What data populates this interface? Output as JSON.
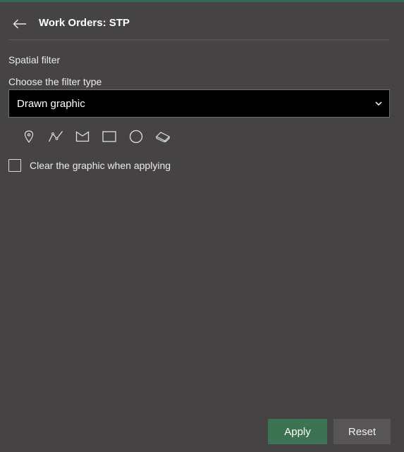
{
  "header": {
    "title": "Work Orders: STP",
    "back_icon": "arrow-left-icon"
  },
  "filter": {
    "section_title": "Spatial filter",
    "type_label": "Choose the filter type",
    "type_value": "Drawn graphic",
    "dropdown_icon": "chevron-down-icon"
  },
  "tools": [
    {
      "name": "point",
      "icon": "point-pin-icon"
    },
    {
      "name": "polyline",
      "icon": "polyline-icon"
    },
    {
      "name": "polygon",
      "icon": "polygon-icon"
    },
    {
      "name": "rectangle",
      "icon": "rectangle-icon"
    },
    {
      "name": "circle",
      "icon": "circle-icon"
    },
    {
      "name": "eraser",
      "icon": "eraser-icon"
    }
  ],
  "options": {
    "clear_graphic_label": "Clear the graphic when applying",
    "clear_graphic_checked": false
  },
  "footer": {
    "apply_label": "Apply",
    "reset_label": "Reset"
  },
  "colors": {
    "background": "#454343",
    "accent": "#3c7353",
    "select_background": "#000000"
  }
}
